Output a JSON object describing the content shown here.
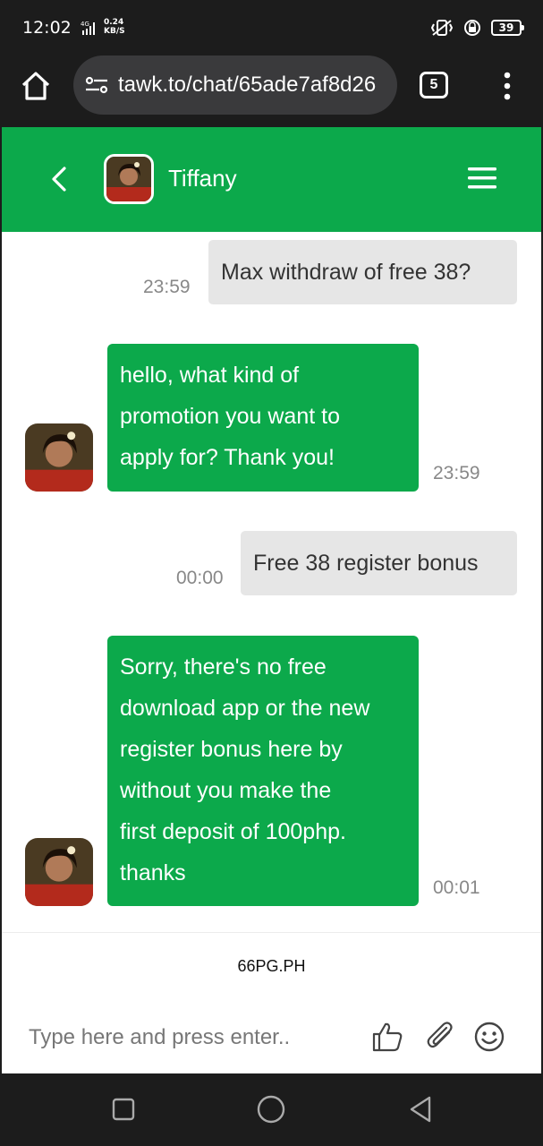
{
  "status_bar": {
    "time": "12:02",
    "network": "4G",
    "speed_value": "0.24",
    "speed_unit": "KB/S",
    "battery": "39"
  },
  "browser": {
    "url": "tawk.to/chat/65ade7af8d26",
    "tab_count": "5"
  },
  "chat_header": {
    "agent_name": "Tiffany"
  },
  "messages": [
    {
      "sender": "visitor",
      "text": "Max withdraw of free 38?",
      "time": "23:59"
    },
    {
      "sender": "agent",
      "lines": [
        "hello, what kind of",
        "promotion you want to",
        "apply for? Thank you!"
      ],
      "time": "23:59"
    },
    {
      "sender": "visitor",
      "text": "Free 38 register bonus",
      "time": "00:00"
    },
    {
      "sender": "agent",
      "lines": [
        "Sorry, there's no free",
        "download app or the new",
        "register bonus here by",
        "without you make the",
        "first deposit of 100php.",
        "thanks"
      ],
      "time": "00:01"
    }
  ],
  "branding": "66PG.PH",
  "composer": {
    "placeholder": "Type here and press enter.."
  },
  "icons": [
    "home-icon",
    "site-settings-icon",
    "more-vert-icon",
    "back-chevron-icon",
    "hamburger-menu-icon",
    "thumbs-up-icon",
    "paperclip-icon",
    "emoji-icon",
    "nav-recents-icon",
    "nav-home-icon",
    "nav-back-icon"
  ],
  "colors": {
    "accent": "#0ca94b",
    "visitor_bubble": "#e6e6e6",
    "chrome": "#1c1c1c"
  }
}
